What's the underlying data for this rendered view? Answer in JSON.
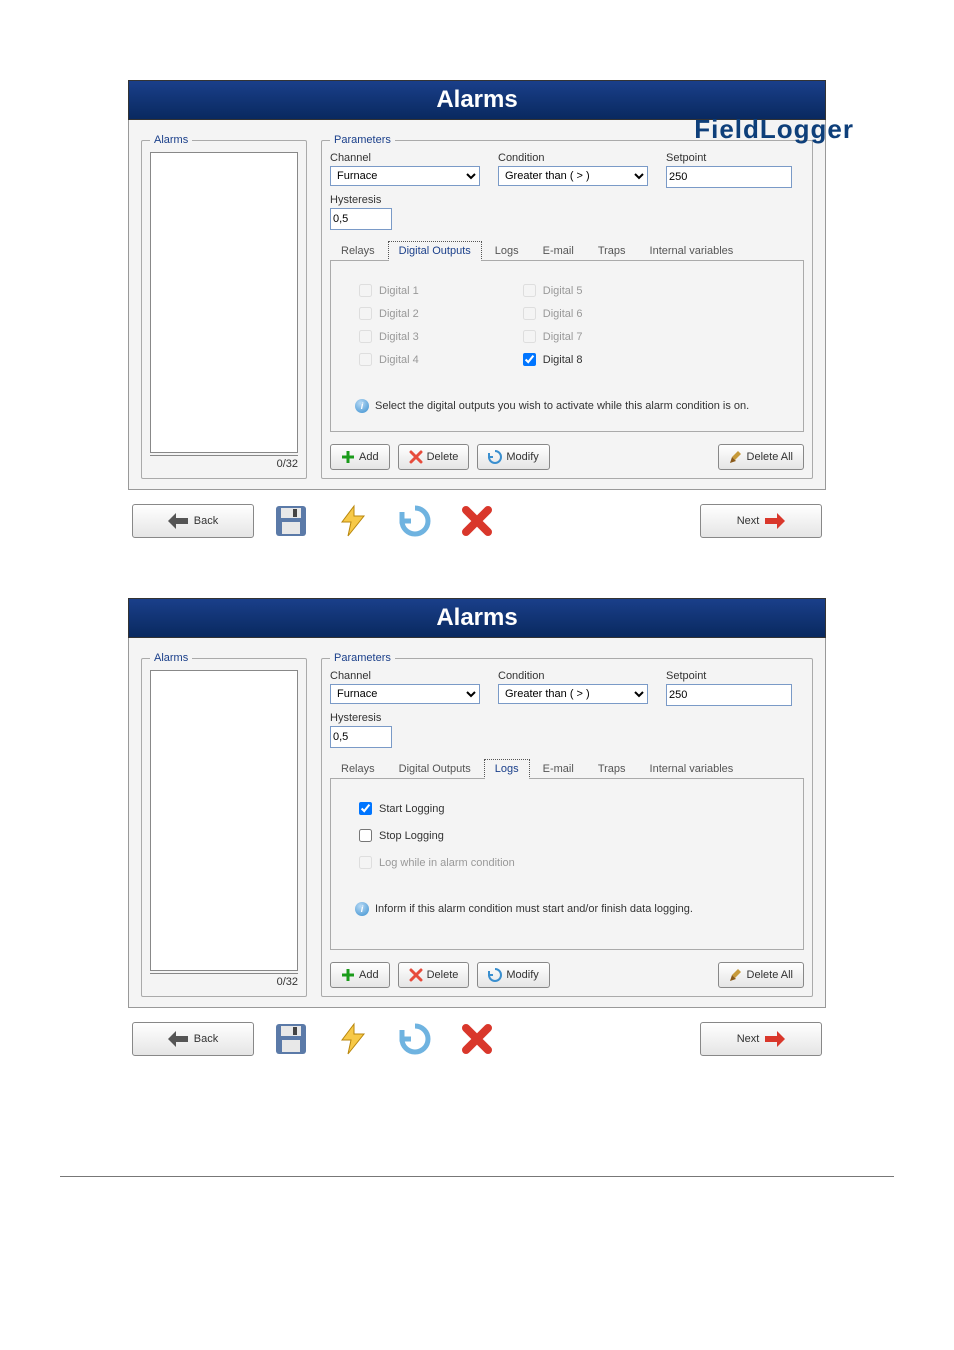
{
  "brand": "FieldLogger",
  "panels": [
    {
      "title": "Alarms",
      "alarms_legend": "Alarms",
      "alarms_counter": "0/32",
      "params_legend": "Parameters",
      "channel_label": "Channel",
      "channel_value": "Furnace",
      "condition_label": "Condition",
      "condition_value": "Greater than ( > )",
      "setpoint_label": "Setpoint",
      "setpoint_value": "250",
      "hysteresis_label": "Hysteresis",
      "hysteresis_value": "0,5",
      "tabs": [
        "Relays",
        "Digital Outputs",
        "Logs",
        "E-mail",
        "Traps",
        "Internal variables"
      ],
      "active_tab": 1,
      "digital": {
        "left": [
          {
            "label": "Digital 1",
            "checked": false,
            "enabled": false
          },
          {
            "label": "Digital 2",
            "checked": false,
            "enabled": false
          },
          {
            "label": "Digital 3",
            "checked": false,
            "enabled": false
          },
          {
            "label": "Digital 4",
            "checked": false,
            "enabled": false
          }
        ],
        "right": [
          {
            "label": "Digital 5",
            "checked": false,
            "enabled": false
          },
          {
            "label": "Digital 6",
            "checked": false,
            "enabled": false
          },
          {
            "label": "Digital 7",
            "checked": false,
            "enabled": false
          },
          {
            "label": "Digital 8",
            "checked": true,
            "enabled": true
          }
        ]
      },
      "info_text": "Select the digital outputs you wish to activate while this alarm condition is on.",
      "buttons": {
        "add": "Add",
        "delete": "Delete",
        "modify": "Modify",
        "delete_all": "Delete All"
      },
      "nav": {
        "back": "Back",
        "next": "Next"
      }
    },
    {
      "title": "Alarms",
      "alarms_legend": "Alarms",
      "alarms_counter": "0/32",
      "params_legend": "Parameters",
      "channel_label": "Channel",
      "channel_value": "Furnace",
      "condition_label": "Condition",
      "condition_value": "Greater than ( > )",
      "setpoint_label": "Setpoint",
      "setpoint_value": "250",
      "hysteresis_label": "Hysteresis",
      "hysteresis_value": "0,5",
      "tabs": [
        "Relays",
        "Digital Outputs",
        "Logs",
        "E-mail",
        "Traps",
        "Internal variables"
      ],
      "active_tab": 2,
      "logs": [
        {
          "label": "Start Logging",
          "checked": true,
          "enabled": true
        },
        {
          "label": "Stop Logging",
          "checked": false,
          "enabled": true
        },
        {
          "label": "Log while in alarm condition",
          "checked": false,
          "enabled": false
        }
      ],
      "info_text": "Inform if this alarm condition must start and/or finish data logging.",
      "buttons": {
        "add": "Add",
        "delete": "Delete",
        "modify": "Modify",
        "delete_all": "Delete All"
      },
      "nav": {
        "back": "Back",
        "next": "Next"
      }
    }
  ]
}
